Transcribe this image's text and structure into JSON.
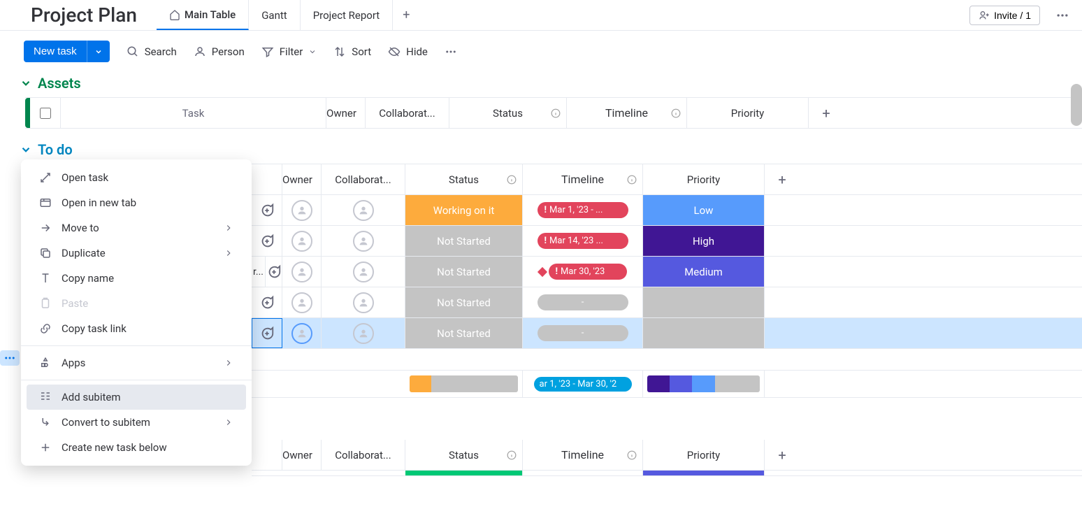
{
  "header": {
    "title": "Project Plan",
    "tabs": [
      "Main Table",
      "Gantt",
      "Project Report"
    ],
    "invite_label": "Invite / 1"
  },
  "toolbar": {
    "new_task": "New task",
    "search": "Search",
    "person": "Person",
    "filter": "Filter",
    "sort": "Sort",
    "hide": "Hide"
  },
  "groups": {
    "assets": {
      "title": "Assets"
    },
    "todo": {
      "title": "To do"
    }
  },
  "columns": {
    "task": "Task",
    "owner": "Owner",
    "collaborators": "Collaborat...",
    "status": "Status",
    "timeline": "Timeline",
    "priority": "Priority"
  },
  "status_labels": {
    "working": "Working on it",
    "notstarted": "Not Started"
  },
  "priority_labels": {
    "low": "Low",
    "high": "High",
    "medium": "Medium"
  },
  "timelines": {
    "r0": "Mar 1, '23 - ...",
    "r1": "Mar 14, '23 ...",
    "r2": "Mar 30, '23",
    "dash": "-",
    "summary": "ar 1, '23 - Mar 30, '2"
  },
  "task_texts": {
    "r2_partial": "r..."
  },
  "context_menu": {
    "open_task": "Open task",
    "open_new_tab": "Open in new tab",
    "move_to": "Move to",
    "duplicate": "Duplicate",
    "copy_name": "Copy name",
    "paste": "Paste",
    "copy_link": "Copy task link",
    "apps": "Apps",
    "add_subitem": "Add subitem",
    "convert_subitem": "Convert to subitem",
    "create_below": "Create new task below"
  }
}
